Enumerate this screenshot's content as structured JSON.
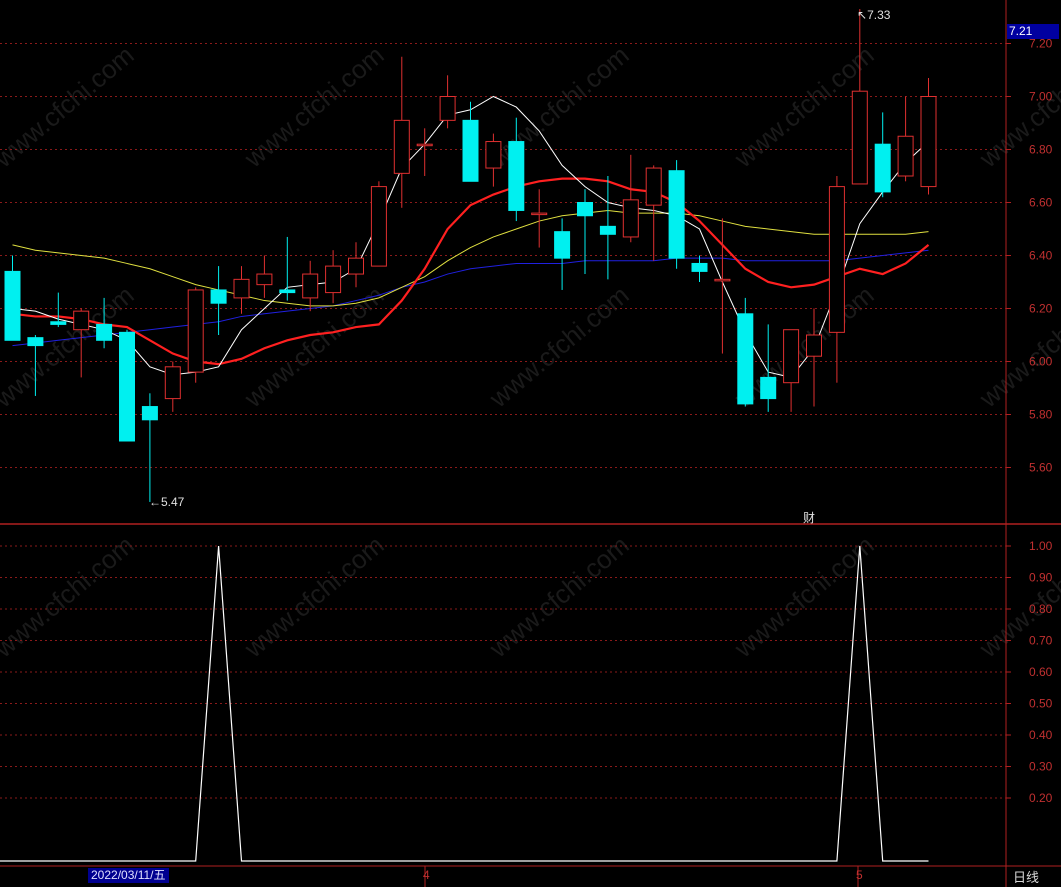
{
  "current_price_badge": "7.21",
  "period_label": "日线",
  "date_label": "2022/03/11/五",
  "month_markers": [
    "4",
    "5"
  ],
  "financial_marker": "财",
  "annotations": {
    "high": "7.33",
    "low": "5.47"
  },
  "watermark": "www.cfchi.com",
  "colors": {
    "up": "#e03030",
    "down": "#00f0f0",
    "ma5": "#ffffff",
    "ma10": "#ff2020",
    "ma20": "#e0e040",
    "ma60": "#2020e0",
    "grid": "#8a1a1a",
    "axis": "#b02020"
  },
  "chart_data": [
    {
      "type": "candlestick",
      "ylim": [
        5.4,
        7.3
      ],
      "yticks": [
        "7.20",
        "7.00",
        "6.80",
        "6.60",
        "6.40",
        "6.20",
        "6.00",
        "5.80",
        "5.60"
      ],
      "candles": [
        {
          "o": 6.34,
          "h": 6.4,
          "l": 6.08,
          "c": 6.08
        },
        {
          "o": 6.09,
          "h": 6.1,
          "l": 5.87,
          "c": 6.06
        },
        {
          "o": 6.15,
          "h": 6.26,
          "l": 6.13,
          "c": 6.14
        },
        {
          "o": 6.12,
          "h": 6.2,
          "l": 5.94,
          "c": 6.19
        },
        {
          "o": 6.14,
          "h": 6.24,
          "l": 6.05,
          "c": 6.08
        },
        {
          "o": 6.11,
          "h": 6.12,
          "l": 5.7,
          "c": 5.7
        },
        {
          "o": 5.83,
          "h": 5.88,
          "l": 5.47,
          "c": 5.78
        },
        {
          "o": 5.86,
          "h": 6.0,
          "l": 5.81,
          "c": 5.98
        },
        {
          "o": 5.96,
          "h": 6.28,
          "l": 5.92,
          "c": 6.27
        },
        {
          "o": 6.27,
          "h": 6.36,
          "l": 6.1,
          "c": 6.22
        },
        {
          "o": 6.24,
          "h": 6.36,
          "l": 6.18,
          "c": 6.31
        },
        {
          "o": 6.29,
          "h": 6.4,
          "l": 6.24,
          "c": 6.33
        },
        {
          "o": 6.27,
          "h": 6.47,
          "l": 6.23,
          "c": 6.26
        },
        {
          "o": 6.24,
          "h": 6.38,
          "l": 6.19,
          "c": 6.33
        },
        {
          "o": 6.26,
          "h": 6.42,
          "l": 6.22,
          "c": 6.36
        },
        {
          "o": 6.33,
          "h": 6.45,
          "l": 6.28,
          "c": 6.39
        },
        {
          "o": 6.36,
          "h": 6.68,
          "l": 6.36,
          "c": 6.66
        },
        {
          "o": 6.71,
          "h": 7.15,
          "l": 6.58,
          "c": 6.91
        },
        {
          "o": 6.82,
          "h": 6.88,
          "l": 6.7,
          "c": 6.82
        },
        {
          "o": 6.91,
          "h": 7.08,
          "l": 6.88,
          "c": 7.0
        },
        {
          "o": 6.91,
          "h": 6.98,
          "l": 6.68,
          "c": 6.68
        },
        {
          "o": 6.73,
          "h": 6.86,
          "l": 6.66,
          "c": 6.83
        },
        {
          "o": 6.83,
          "h": 6.92,
          "l": 6.53,
          "c": 6.57
        },
        {
          "o": 6.56,
          "h": 6.65,
          "l": 6.43,
          "c": 6.56
        },
        {
          "o": 6.49,
          "h": 6.54,
          "l": 6.27,
          "c": 6.39
        },
        {
          "o": 6.6,
          "h": 6.65,
          "l": 6.33,
          "c": 6.55
        },
        {
          "o": 6.51,
          "h": 6.7,
          "l": 6.31,
          "c": 6.48
        },
        {
          "o": 6.47,
          "h": 6.78,
          "l": 6.45,
          "c": 6.61
        },
        {
          "o": 6.59,
          "h": 6.74,
          "l": 6.38,
          "c": 6.73
        },
        {
          "o": 6.72,
          "h": 6.76,
          "l": 6.35,
          "c": 6.39
        },
        {
          "o": 6.37,
          "h": 6.4,
          "l": 6.3,
          "c": 6.34
        },
        {
          "o": 6.31,
          "h": 6.54,
          "l": 6.03,
          "c": 6.31
        },
        {
          "o": 6.18,
          "h": 6.24,
          "l": 5.83,
          "c": 5.84
        },
        {
          "o": 5.94,
          "h": 6.14,
          "l": 5.81,
          "c": 5.86
        },
        {
          "o": 5.92,
          "h": 6.11,
          "l": 5.81,
          "c": 6.12
        },
        {
          "o": 6.02,
          "h": 6.2,
          "l": 5.83,
          "c": 6.1
        },
        {
          "o": 6.11,
          "h": 6.7,
          "l": 5.92,
          "c": 6.66
        },
        {
          "o": 6.67,
          "h": 7.33,
          "l": 6.67,
          "c": 7.02
        },
        {
          "o": 6.82,
          "h": 6.94,
          "l": 6.62,
          "c": 6.64
        },
        {
          "o": 6.7,
          "h": 7.0,
          "l": 6.68,
          "c": 6.85
        },
        {
          "o": 6.66,
          "h": 7.07,
          "l": 6.63,
          "c": 7.0
        }
      ],
      "ma5": [
        6.2,
        6.19,
        6.16,
        6.14,
        6.12,
        6.08,
        5.98,
        5.95,
        5.96,
        5.98,
        6.12,
        6.2,
        6.28,
        6.29,
        6.3,
        6.35,
        6.53,
        6.73,
        6.82,
        6.93,
        6.95,
        7.0,
        6.96,
        6.87,
        6.74,
        6.66,
        6.6,
        6.58,
        6.57,
        6.55,
        6.5,
        6.3,
        6.11,
        5.96,
        5.94,
        6.05,
        6.27,
        6.52,
        6.64,
        6.75,
        6.83
      ],
      "ma10": [
        6.18,
        6.17,
        6.17,
        6.16,
        6.14,
        6.13,
        6.08,
        6.03,
        6.0,
        5.99,
        6.01,
        6.05,
        6.08,
        6.1,
        6.11,
        6.13,
        6.14,
        6.23,
        6.35,
        6.5,
        6.59,
        6.63,
        6.66,
        6.68,
        6.69,
        6.69,
        6.68,
        6.65,
        6.64,
        6.6,
        6.53,
        6.44,
        6.35,
        6.3,
        6.28,
        6.29,
        6.32,
        6.35,
        6.33,
        6.37,
        6.44
      ],
      "ma20": [
        6.44,
        6.42,
        6.41,
        6.4,
        6.39,
        6.37,
        6.35,
        6.32,
        6.29,
        6.27,
        6.25,
        6.23,
        6.22,
        6.21,
        6.21,
        6.22,
        6.24,
        6.28,
        6.32,
        6.38,
        6.43,
        6.47,
        6.5,
        6.53,
        6.55,
        6.56,
        6.57,
        6.56,
        6.56,
        6.56,
        6.55,
        6.53,
        6.51,
        6.5,
        6.49,
        6.48,
        6.48,
        6.48,
        6.48,
        6.48,
        6.49
      ],
      "ma60": [
        6.06,
        6.07,
        6.08,
        6.09,
        6.1,
        6.11,
        6.12,
        6.13,
        6.14,
        6.15,
        6.17,
        6.18,
        6.19,
        6.2,
        6.21,
        6.23,
        6.25,
        6.28,
        6.3,
        6.33,
        6.35,
        6.36,
        6.37,
        6.37,
        6.37,
        6.38,
        6.38,
        6.38,
        6.38,
        6.39,
        6.39,
        6.39,
        6.38,
        6.38,
        6.38,
        6.38,
        6.38,
        6.39,
        6.4,
        6.41,
        6.42
      ]
    },
    {
      "type": "line",
      "ylim": [
        0,
        1.06
      ],
      "yticks": [
        "1.00",
        "0.90",
        "0.80",
        "0.70",
        "0.60",
        "0.50",
        "0.40",
        "0.30",
        "0.20"
      ],
      "values": [
        0,
        0,
        0,
        0,
        0,
        0,
        0,
        0,
        0,
        1,
        0,
        0,
        0,
        0,
        0,
        0,
        0,
        0,
        0,
        0,
        0,
        0,
        0,
        0,
        0,
        0,
        0,
        0,
        0,
        0,
        0,
        0,
        0,
        0,
        0,
        0,
        0,
        1,
        0,
        0,
        0
      ]
    }
  ]
}
